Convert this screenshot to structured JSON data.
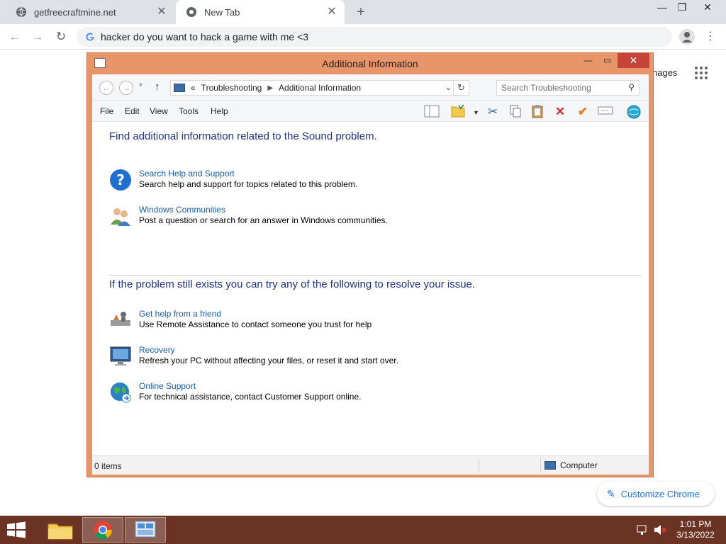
{
  "browser": {
    "tabs": [
      {
        "title": "getfreecraftmine.net",
        "active": false
      },
      {
        "title": "New Tab",
        "active": true
      }
    ],
    "new_tab_glyph": "+",
    "omnibox_text": "hacker do you want to hack a game with me <3",
    "window_controls": {
      "minimize": "—",
      "restore": "❐",
      "close": "✕"
    },
    "ntp": {
      "images_link": "nages",
      "customize_label": "Customize Chrome"
    }
  },
  "dialog": {
    "title": "Additional Information",
    "address": {
      "chevrons": "«",
      "crumbs": [
        "Troubleshooting",
        "Additional Information"
      ]
    },
    "search_placeholder": "Search Troubleshooting",
    "menu": [
      "File",
      "Edit",
      "View",
      "Tools",
      "Help"
    ],
    "section1_heading": "Find additional information related to the Sound problem.",
    "section1_items": [
      {
        "link": "Search Help and Support",
        "desc": "Search help and support for topics related to this problem.",
        "icon": "help-icon"
      },
      {
        "link": "Windows Communities",
        "desc": "Post a question or search for an answer in Windows communities.",
        "icon": "people-icon"
      }
    ],
    "section2_heading": "If the problem still exists you can try any of the following to resolve your issue.",
    "section2_items": [
      {
        "link": "Get help from a friend",
        "desc": "Use Remote Assistance to contact someone you trust for help",
        "icon": "remote-assistance-icon"
      },
      {
        "link": "Recovery",
        "desc": "Refresh your PC without affecting your files, or reset it and start over.",
        "icon": "recovery-icon"
      },
      {
        "link": "Online Support",
        "desc": "For technical assistance, contact Customer Support online.",
        "icon": "globe-icon"
      }
    ],
    "status": {
      "count": "0 items",
      "location": "Computer"
    }
  },
  "taskbar": {
    "clock_time": "1:01 PM",
    "clock_date": "3/13/2022"
  },
  "colors": {
    "window_frame": "#e9956a",
    "taskbar": "#6b3324",
    "link": "#1a5ea8",
    "heading": "#1e3287"
  }
}
